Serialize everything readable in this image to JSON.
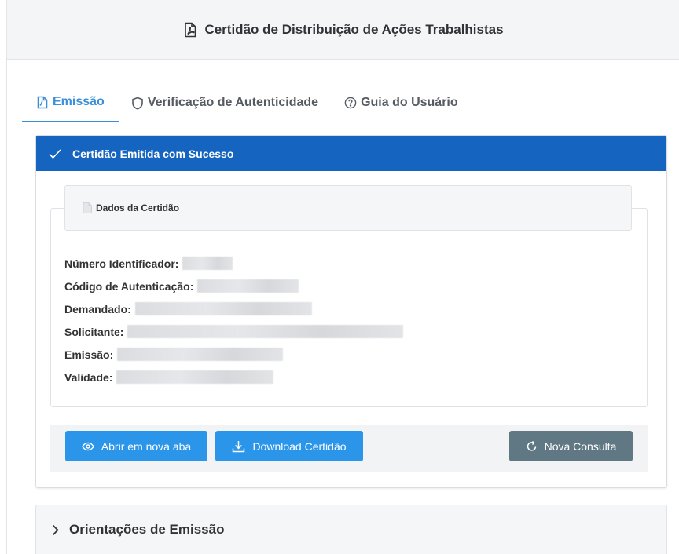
{
  "header": {
    "title": "Certidão de Distribuição de Ações Trabalhistas",
    "icon": "pdf-file-icon"
  },
  "tabs": [
    {
      "label": "Emissão",
      "icon": "pdf-file-icon",
      "active": true
    },
    {
      "label": "Verificação de Autenticidade",
      "icon": "shield-icon",
      "active": false
    },
    {
      "label": "Guia do Usuário",
      "icon": "help-circle-icon",
      "active": false
    }
  ],
  "card": {
    "status_title": "Certidão Emitida com Sucesso",
    "section_title": "Dados da Certidão",
    "fields": [
      {
        "label": "Número Identificador:"
      },
      {
        "label": "Código de Autenticação:"
      },
      {
        "label": "Demandado:"
      },
      {
        "label": "Solicitante:"
      },
      {
        "label": "Emissão:"
      },
      {
        "label": "Validade:"
      }
    ]
  },
  "actions": {
    "open_new_tab": "Abrir em nova aba",
    "download": "Download Certidão",
    "new_query": "Nova Consulta"
  },
  "accordion": {
    "label": "Orientações de Emissão"
  },
  "colors": {
    "primary": "#1565c0",
    "tab_active": "#3a8fd9",
    "button_blue": "#2b95e9",
    "button_gray": "#5f7883"
  }
}
